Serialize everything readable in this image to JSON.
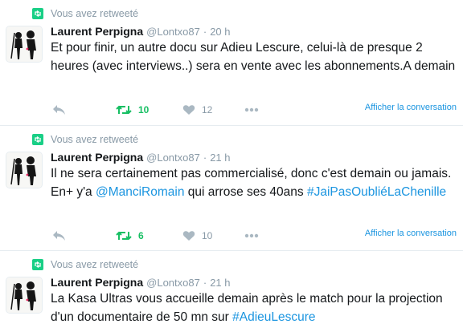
{
  "colors": {
    "retweet_green": "#17bf63",
    "link_blue": "#1b95e0",
    "muted_gray": "#8899a6",
    "rt_context_icon": "#19cf86"
  },
  "tweets": [
    {
      "retweet_context": "Vous avez retweeté",
      "author": {
        "name": "Laurent Perpigna",
        "handle": "@Lontxo87",
        "time": "20 h"
      },
      "text_parts": [
        {
          "t": "Et pour finir, un autre docu sur Adieu Lescure, celui-là de presque 2 heures (avec interviews..) sera en vente avec les abonnements.A demain",
          "link": false
        }
      ],
      "retweet_count": "10",
      "like_count": "12",
      "conversation_label": "Afficher la conversation",
      "icons": [
        "reply-icon",
        "retweet-icon",
        "heart-icon",
        "more-icon"
      ]
    },
    {
      "retweet_context": "Vous avez retweeté",
      "author": {
        "name": "Laurent Perpigna",
        "handle": "@Lontxo87",
        "time": "21 h"
      },
      "text_parts": [
        {
          "t": "Il ne sera certainement pas commercialisé, donc c'est demain ou jamais. En+ y'a ",
          "link": false
        },
        {
          "t": "@ManciRomain",
          "link": true
        },
        {
          "t": " qui arrose ses 40ans ",
          "link": false
        },
        {
          "t": "#JaiPasOubliéLaChenille",
          "link": true
        }
      ],
      "retweet_count": "6",
      "like_count": "10",
      "conversation_label": "Afficher la conversation",
      "icons": [
        "reply-icon",
        "retweet-icon",
        "heart-icon",
        "more-icon"
      ]
    },
    {
      "retweet_context": "Vous avez retweeté",
      "author": {
        "name": "Laurent Perpigna",
        "handle": "@Lontxo87",
        "time": "21 h"
      },
      "text_parts": [
        {
          "t": "La Kasa Ultras vous accueille demain après le match pour la projection d'un documentaire de 50 mn sur ",
          "link": false
        },
        {
          "t": "#AdieuLescure",
          "link": true
        }
      ]
    }
  ]
}
